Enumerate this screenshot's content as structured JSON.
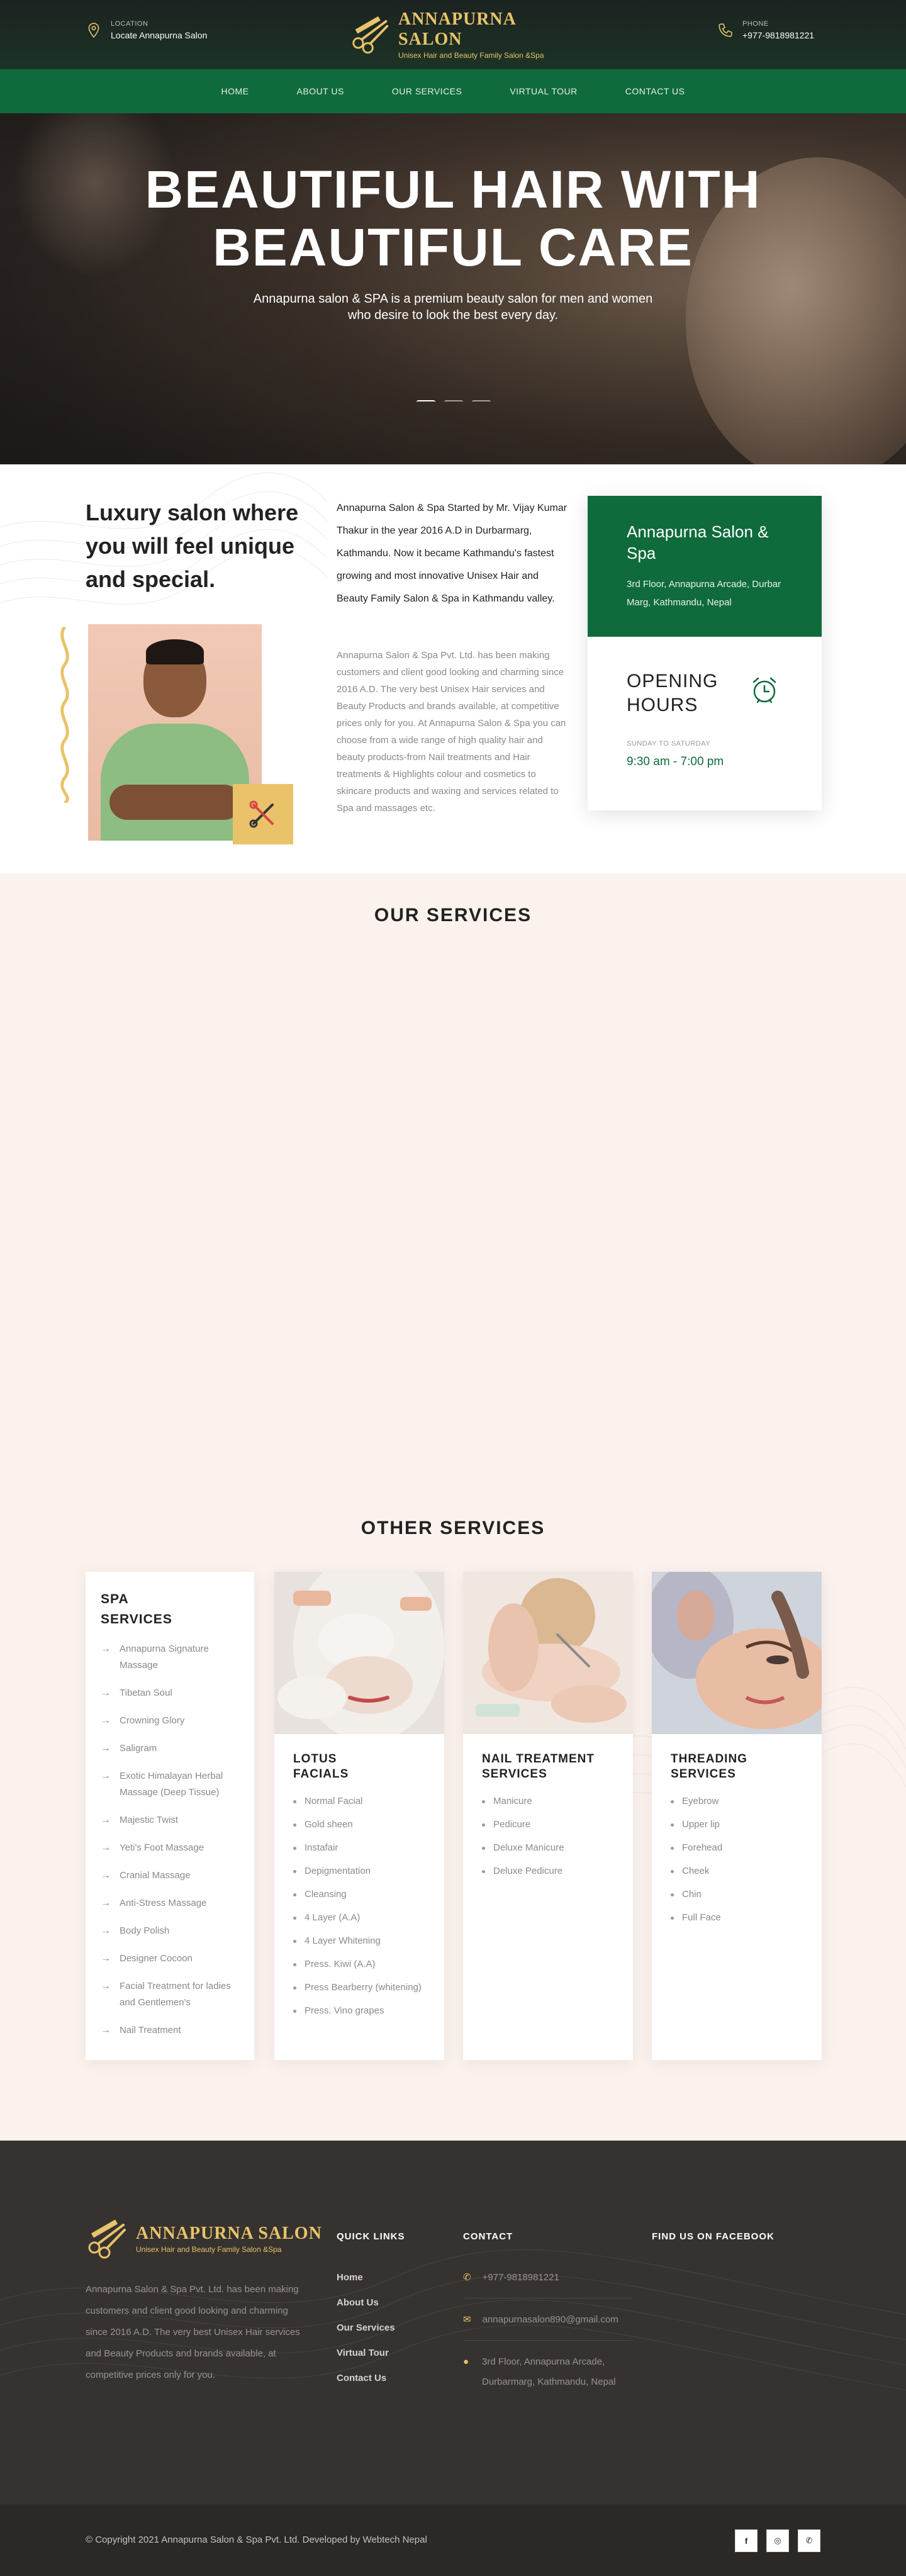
{
  "header": {
    "location_label": "LOCATION",
    "location_value": "Locate Annapurna Salon",
    "logo_title": "ANNAPURNA SALON",
    "logo_subtitle": "Unisex Hair and Beauty Family Salon &Spa",
    "phone_label": "PHONE",
    "phone_value": "+977-9818981221"
  },
  "nav": [
    "HOME",
    "ABOUT US",
    "OUR SERVICES",
    "VIRTUAL TOUR",
    "CONTACT US"
  ],
  "hero": {
    "title_line1": "BEAUTIFUL HAIR WITH",
    "title_line2": "BEAUTIFUL CARE",
    "subtitle_line1": "Annapurna salon & SPA is a premium beauty salon for men and women",
    "subtitle_line2": "who desire to look the best every day."
  },
  "about": {
    "heading": "Luxury salon where you will feel unique and special.",
    "bold_text": "Annapurna Salon & Spa Started by Mr. Vijay Kumar Thakur in the year 2016 A.D in Durbarmarg, Kathmandu. Now it became Kathmandu's fastest growing and most innovative Unisex Hair and Beauty Family Salon & Spa in Kathmandu valley.",
    "body_text": "Annapurna Salon & Spa Pvt. Ltd. has been making customers and client good looking and charming since 2016 A.D. The very best Unisex Hair services and Beauty Products and brands available, at competitive prices only for you. At Annapurna Salon & Spa you can choose from a wide range of high quality hair and beauty products-from Nail treatments and Hair treatments & Highlights colour and cosmetics to skincare products and waxing and services related to Spa and massages etc."
  },
  "info_card": {
    "name": "Annapurna Salon & Spa",
    "address": "3rd Floor, Annapurna Arcade, Durbar Marg, Kathmandu, Nepal",
    "hours_title_line1": "OPENING",
    "hours_title_line2": "HOURS",
    "days": "SUNDAY TO SATURDAY",
    "time": "9:30 am - 7:00 pm"
  },
  "sections": {
    "our_services": "OUR SERVICES",
    "other_services": "OTHER SERVICES"
  },
  "spa": {
    "title_line1": "SPA",
    "title_line2": "SERVICES",
    "items": [
      "Annapurna Signature Massage",
      "Tibetan Soul",
      "Crowning Glory",
      "Saligram",
      "Exotic Himalayan Herbal Massage (Deep Tissue)",
      "Majestic Twist",
      "Yeti's Foot Massage",
      "Cranial Massage",
      "Anti-Stress Massage",
      "Body Polish",
      "Designer Cocoon",
      "Facial Treatment for ladies and Gentlemen's",
      "Nail Treatment"
    ]
  },
  "services": [
    {
      "title_line1": "LOTUS",
      "title_line2": "FACIALS",
      "items": [
        "Normal Facial",
        "Gold sheen",
        "Instafair",
        "Depigmentation",
        "Cleansing",
        "4 Layer (A.A)",
        "4 Layer Whitening",
        "Press. Kiwi (A.A)",
        "Press Bearberry (whitening)",
        "Press. Vino grapes"
      ]
    },
    {
      "title_line1": "NAIL TREATMENT",
      "title_line2": "SERVICES",
      "items": [
        "Manicure",
        "Pedicure",
        "Deluxe Manicure",
        "Deluxe Pedicure"
      ]
    },
    {
      "title_line1": "THREADING",
      "title_line2": "SERVICES",
      "items": [
        "Eyebrow",
        "Upper lip",
        "Forehead",
        "Cheek",
        "Chin",
        "Full Face"
      ]
    }
  ],
  "footer": {
    "about": "Annapurna Salon & Spa Pvt. Ltd. has been making customers and client good looking and charming since 2016 A.D. The very best Unisex Hair services and Beauty Products and brands available, at competitive prices only for you.",
    "quick_links_title": "QUICK LINKS",
    "quick_links": [
      "Home",
      "About Us",
      "Our Services",
      "Virtual Tour",
      "Contact Us"
    ],
    "contact_title": "CONTACT",
    "phone": "+977-9818981221",
    "email": "annapurnasalon890@gmail.com",
    "address": "3rd Floor, Annapurna Arcade, Durbarmarg, Kathmandu, Nepal",
    "facebook_title": "FIND US ON FACEBOOK",
    "copyright": "© Copyright 2021 Annapurna Salon & Spa Pvt. Ltd. Developed by Webtech Nepal"
  },
  "colors": {
    "brand_green": "#0f6b3c",
    "gold": "#e8c36a",
    "services_bg": "#fbf2ee",
    "footer_bg": "#363230"
  },
  "icons": [
    "location-pin-icon",
    "phone-icon",
    "scissors-comb-icon",
    "alarm-clock-icon",
    "arrow-right-icon",
    "mail-icon",
    "facebook-icon",
    "instagram-icon",
    "whatsapp-icon"
  ]
}
